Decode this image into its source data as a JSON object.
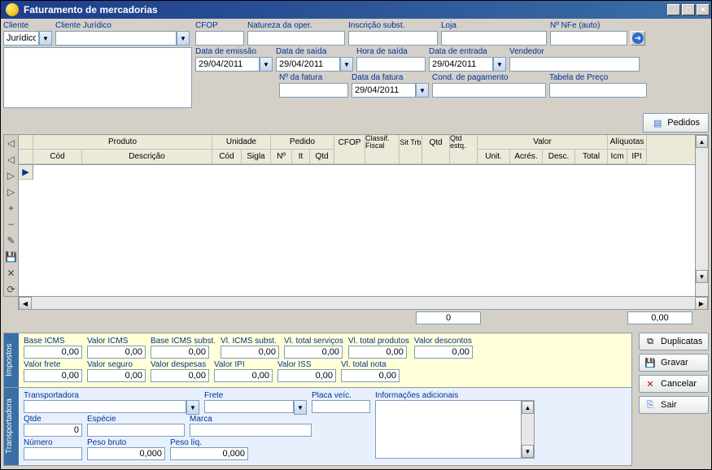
{
  "title": "Faturamento de mercadorias",
  "header": {
    "cliente_label": "Cliente",
    "cliente_value": "Jurídico",
    "cliente_juridico_label": "Cliente Jurídico",
    "cfop_label": "CFOP",
    "natureza_label": "Natureza da oper.",
    "inscricao_label": "Inscrição subst.",
    "loja_label": "Loja",
    "nfe_label": "Nº NFe (auto)",
    "data_emissao_label": "Data de emissão",
    "data_emissao": "29/04/2011",
    "data_saida_label": "Data de saída",
    "data_saida": "29/04/2011",
    "hora_saida_label": "Hora de saída",
    "data_entrada_label": "Data de entrada",
    "data_entrada": "29/04/2011",
    "vendedor_label": "Vendedor",
    "n_fatura_label": "Nº da fatura",
    "data_fatura_label": "Data da fatura",
    "data_fatura": "29/04/2011",
    "cond_pagto_label": "Cond. de pagamento",
    "tabela_preco_label": "Tabela de Preço"
  },
  "pedidos_btn": "Pedidos",
  "grid": {
    "groups": {
      "produto": "Produto",
      "unidade": "Unidade",
      "pedido": "Pedido",
      "valor": "Valor",
      "aliquotas": "Alíquotas"
    },
    "cols": {
      "cod": "Cód",
      "descricao": "Descrição",
      "ucod": "Cód",
      "sigla": "Sigla",
      "no": "Nº",
      "it": "It",
      "qtd": "Qtd",
      "cfop": "CFOP",
      "classif": "Classif. Fiscal",
      "sit": "Sit Trb",
      "qtd2": "Qtd",
      "qtd_estq": "Qtd estq.",
      "unit": "Unit.",
      "acres": "Acrés.",
      "desc": "Desc.",
      "total": "Total",
      "icm": "Icm",
      "ipi": "IPI"
    }
  },
  "totals": {
    "qtd": "0",
    "valor": "0,00"
  },
  "impostos": {
    "tab": "Impostos",
    "base_icms": "Base ICMS",
    "valor_icms": "Valor ICMS",
    "base_icms_subst": "Base ICMS subst.",
    "vl_icms_subst": "Vl. ICMS subst.",
    "vl_total_servicos": "Vl. total serviços",
    "vl_total_produtos": "Vl. total produtos",
    "valor_descontos": "Valor descontos",
    "valor_frete": "Valor frete",
    "valor_seguro": "Valor seguro",
    "valor_despesas": "Valor despesas",
    "valor_ipi": "Valor IPI",
    "valor_iss": "Valor ISS",
    "vl_total_nota": "Vl. total nota",
    "zero": "0,00"
  },
  "transportadora": {
    "tab": "Transportadora",
    "transportadora_label": "Transportadora",
    "frete_label": "Frete",
    "placa_label": "Placa veíc.",
    "info_label": "Informações adicionais",
    "qtde_label": "Qtde",
    "especie_label": "Espécie",
    "marca_label": "Marca",
    "numero_label": "Número",
    "peso_bruto_label": "Peso bruto",
    "peso_liq_label": "Peso líq.",
    "qtde": "0",
    "peso_bruto": "0,000",
    "peso_liq": "0,000"
  },
  "actions": {
    "duplicatas": "Duplicatas",
    "gravar": "Gravar",
    "cancelar": "Cancelar",
    "sair": "Sair"
  }
}
